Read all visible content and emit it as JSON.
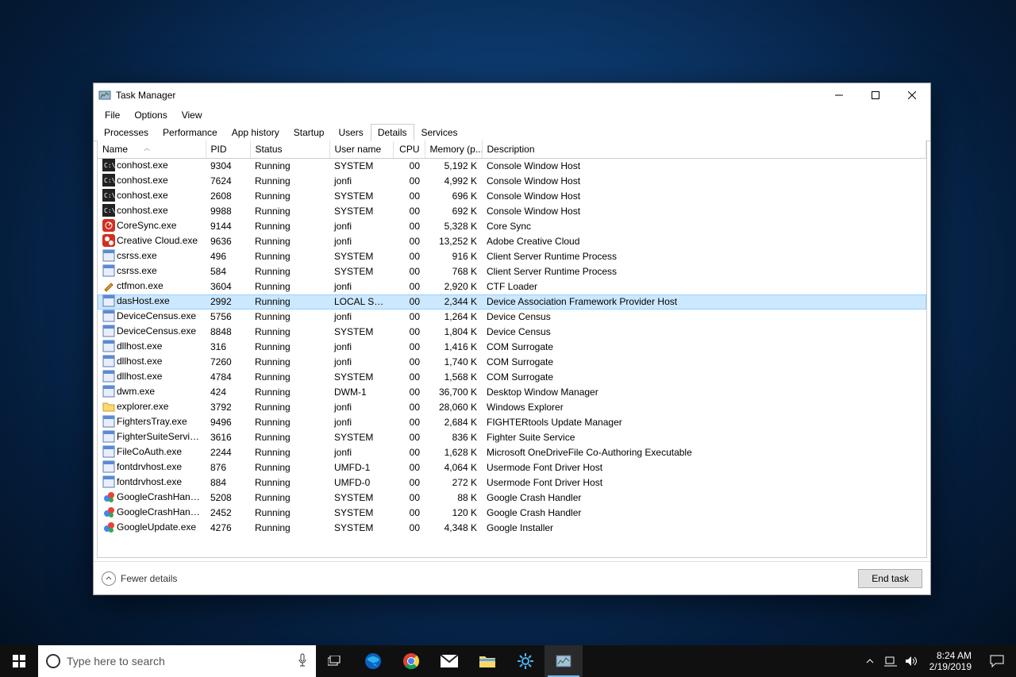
{
  "window": {
    "title": "Task Manager",
    "menus": [
      "File",
      "Options",
      "View"
    ],
    "tabs": [
      "Processes",
      "Performance",
      "App history",
      "Startup",
      "Users",
      "Details",
      "Services"
    ],
    "active_tab": 5,
    "columns": [
      "Name",
      "PID",
      "Status",
      "User name",
      "CPU",
      "Memory (p...",
      "Description"
    ],
    "sort_col": 0,
    "selected_row": 9,
    "processes": [
      {
        "icon": "console",
        "name": "conhost.exe",
        "pid": "9304",
        "status": "Running",
        "user": "SYSTEM",
        "cpu": "00",
        "mem": "5,192 K",
        "desc": "Console Window Host"
      },
      {
        "icon": "console",
        "name": "conhost.exe",
        "pid": "7624",
        "status": "Running",
        "user": "jonfi",
        "cpu": "00",
        "mem": "4,992 K",
        "desc": "Console Window Host"
      },
      {
        "icon": "console",
        "name": "conhost.exe",
        "pid": "2608",
        "status": "Running",
        "user": "SYSTEM",
        "cpu": "00",
        "mem": "696 K",
        "desc": "Console Window Host"
      },
      {
        "icon": "console",
        "name": "conhost.exe",
        "pid": "9988",
        "status": "Running",
        "user": "SYSTEM",
        "cpu": "00",
        "mem": "692 K",
        "desc": "Console Window Host"
      },
      {
        "icon": "coresync",
        "name": "CoreSync.exe",
        "pid": "9144",
        "status": "Running",
        "user": "jonfi",
        "cpu": "00",
        "mem": "5,328 K",
        "desc": "Core Sync"
      },
      {
        "icon": "cc",
        "name": "Creative Cloud.exe",
        "pid": "9636",
        "status": "Running",
        "user": "jonfi",
        "cpu": "00",
        "mem": "13,252 K",
        "desc": "Adobe Creative Cloud"
      },
      {
        "icon": "exe",
        "name": "csrss.exe",
        "pid": "496",
        "status": "Running",
        "user": "SYSTEM",
        "cpu": "00",
        "mem": "916 K",
        "desc": "Client Server Runtime Process"
      },
      {
        "icon": "exe",
        "name": "csrss.exe",
        "pid": "584",
        "status": "Running",
        "user": "SYSTEM",
        "cpu": "00",
        "mem": "768 K",
        "desc": "Client Server Runtime Process"
      },
      {
        "icon": "pen",
        "name": "ctfmon.exe",
        "pid": "3604",
        "status": "Running",
        "user": "jonfi",
        "cpu": "00",
        "mem": "2,920 K",
        "desc": "CTF Loader"
      },
      {
        "icon": "exe",
        "name": "dasHost.exe",
        "pid": "2992",
        "status": "Running",
        "user": "LOCAL SE...",
        "cpu": "00",
        "mem": "2,344 K",
        "desc": "Device Association Framework Provider Host"
      },
      {
        "icon": "exe",
        "name": "DeviceCensus.exe",
        "pid": "5756",
        "status": "Running",
        "user": "jonfi",
        "cpu": "00",
        "mem": "1,264 K",
        "desc": "Device Census"
      },
      {
        "icon": "exe",
        "name": "DeviceCensus.exe",
        "pid": "8848",
        "status": "Running",
        "user": "SYSTEM",
        "cpu": "00",
        "mem": "1,804 K",
        "desc": "Device Census"
      },
      {
        "icon": "exe",
        "name": "dllhost.exe",
        "pid": "316",
        "status": "Running",
        "user": "jonfi",
        "cpu": "00",
        "mem": "1,416 K",
        "desc": "COM Surrogate"
      },
      {
        "icon": "exe",
        "name": "dllhost.exe",
        "pid": "7260",
        "status": "Running",
        "user": "jonfi",
        "cpu": "00",
        "mem": "1,740 K",
        "desc": "COM Surrogate"
      },
      {
        "icon": "exe",
        "name": "dllhost.exe",
        "pid": "4784",
        "status": "Running",
        "user": "SYSTEM",
        "cpu": "00",
        "mem": "1,568 K",
        "desc": "COM Surrogate"
      },
      {
        "icon": "exe",
        "name": "dwm.exe",
        "pid": "424",
        "status": "Running",
        "user": "DWM-1",
        "cpu": "00",
        "mem": "36,700 K",
        "desc": "Desktop Window Manager"
      },
      {
        "icon": "folder",
        "name": "explorer.exe",
        "pid": "3792",
        "status": "Running",
        "user": "jonfi",
        "cpu": "00",
        "mem": "28,060 K",
        "desc": "Windows Explorer"
      },
      {
        "icon": "exe",
        "name": "FightersTray.exe",
        "pid": "9496",
        "status": "Running",
        "user": "jonfi",
        "cpu": "00",
        "mem": "2,684 K",
        "desc": "FIGHTERtools Update Manager"
      },
      {
        "icon": "exe",
        "name": "FighterSuiteService.e...",
        "pid": "3616",
        "status": "Running",
        "user": "SYSTEM",
        "cpu": "00",
        "mem": "836 K",
        "desc": "Fighter Suite Service"
      },
      {
        "icon": "exe",
        "name": "FileCoAuth.exe",
        "pid": "2244",
        "status": "Running",
        "user": "jonfi",
        "cpu": "00",
        "mem": "1,628 K",
        "desc": "Microsoft OneDriveFile Co-Authoring Executable"
      },
      {
        "icon": "exe",
        "name": "fontdrvhost.exe",
        "pid": "876",
        "status": "Running",
        "user": "UMFD-1",
        "cpu": "00",
        "mem": "4,064 K",
        "desc": "Usermode Font Driver Host"
      },
      {
        "icon": "exe",
        "name": "fontdrvhost.exe",
        "pid": "884",
        "status": "Running",
        "user": "UMFD-0",
        "cpu": "00",
        "mem": "272 K",
        "desc": "Usermode Font Driver Host"
      },
      {
        "icon": "google",
        "name": "GoogleCrashHandler...",
        "pid": "5208",
        "status": "Running",
        "user": "SYSTEM",
        "cpu": "00",
        "mem": "88 K",
        "desc": "Google Crash Handler"
      },
      {
        "icon": "google",
        "name": "GoogleCrashHandler...",
        "pid": "2452",
        "status": "Running",
        "user": "SYSTEM",
        "cpu": "00",
        "mem": "120 K",
        "desc": "Google Crash Handler"
      },
      {
        "icon": "google",
        "name": "GoogleUpdate.exe",
        "pid": "4276",
        "status": "Running",
        "user": "SYSTEM",
        "cpu": "00",
        "mem": "4,348 K",
        "desc": "Google Installer"
      }
    ],
    "fewer_label": "Fewer details",
    "endtask_label": "End task"
  },
  "taskbar": {
    "search_placeholder": "Type here to search",
    "time": "8:24 AM",
    "date": "2/19/2019"
  }
}
